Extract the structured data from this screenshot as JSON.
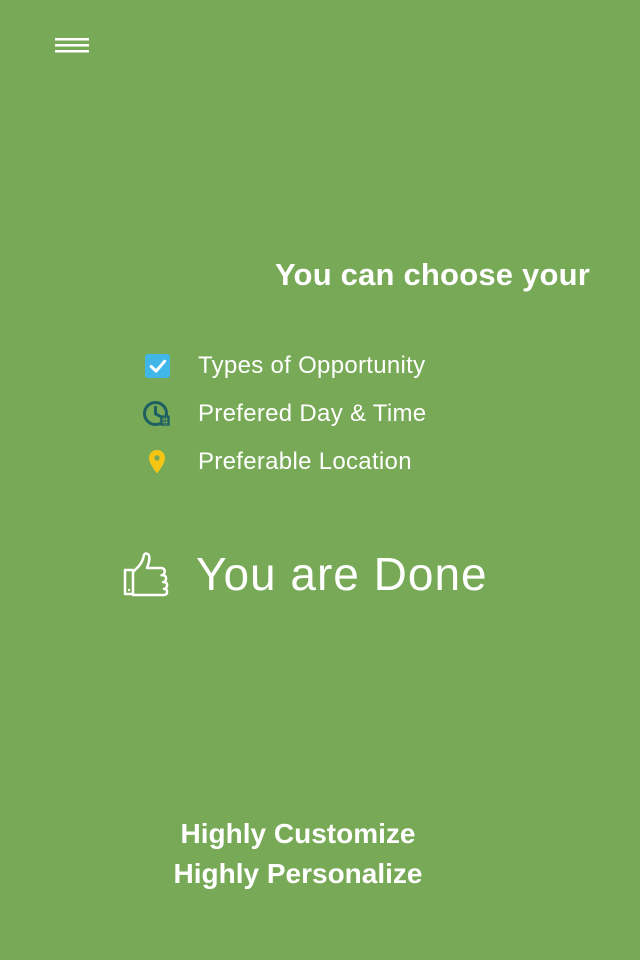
{
  "header": {
    "menu_icon": "hamburger-menu-icon"
  },
  "heading": {
    "title": "You can choose your"
  },
  "options": [
    {
      "icon": "checkbox-checked-icon",
      "label": "Types of Opportunity"
    },
    {
      "icon": "clock-calendar-icon",
      "label": "Prefered Day & Time"
    },
    {
      "icon": "location-pin-icon",
      "label": "Preferable Location"
    }
  ],
  "done": {
    "icon": "thumbs-up-icon",
    "label": "You are Done"
  },
  "footer": {
    "line1": "Highly Customize",
    "line2": "Highly Personalize"
  },
  "colors": {
    "background": "#77a956",
    "text": "#ffffff",
    "checkbox": "#40b6e9",
    "clock": "#1e5f63",
    "pin": "#f7c613"
  }
}
